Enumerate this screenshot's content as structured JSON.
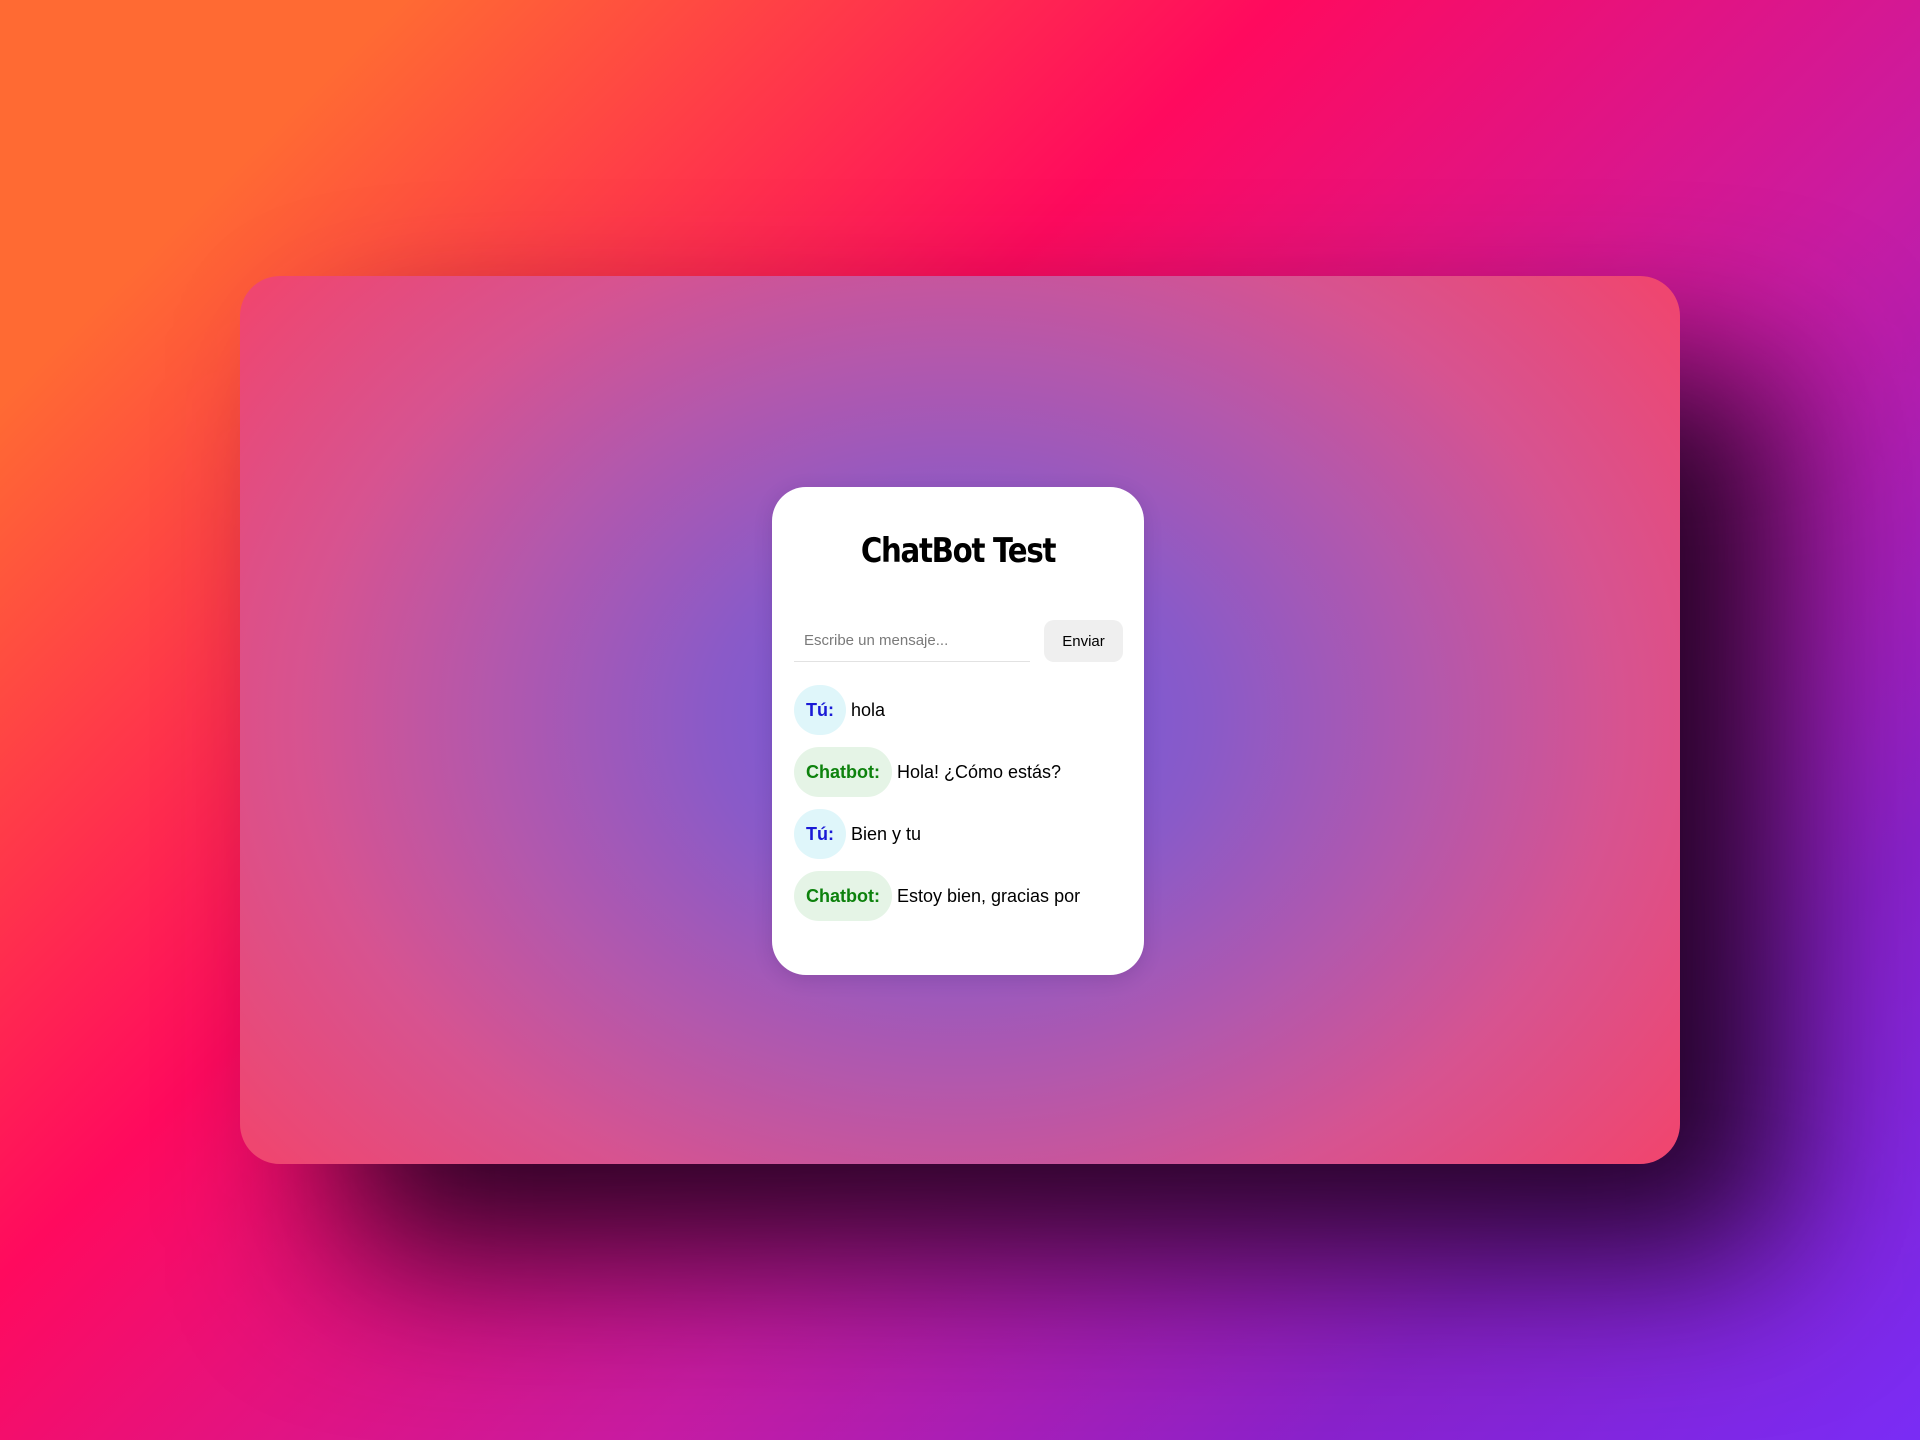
{
  "app": {
    "title": "ChatBot Test"
  },
  "composer": {
    "placeholder": "Escribe un mensaje...",
    "value": "",
    "send_label": "Enviar"
  },
  "messages": [
    {
      "sender": "Tú:",
      "role": "user",
      "text": "hola"
    },
    {
      "sender": "Chatbot:",
      "role": "bot",
      "text": "Hola! ¿Cómo estás?"
    },
    {
      "sender": "Tú:",
      "role": "user",
      "text": "Bien y tu"
    },
    {
      "sender": "Chatbot:",
      "role": "bot",
      "text": "Estoy bien, gracias por"
    }
  ],
  "colors": {
    "user_label": "#1a1ad6",
    "user_bubble": "#dff6fa",
    "bot_label": "#0d820d",
    "bot_bubble": "#e5f4e6"
  }
}
